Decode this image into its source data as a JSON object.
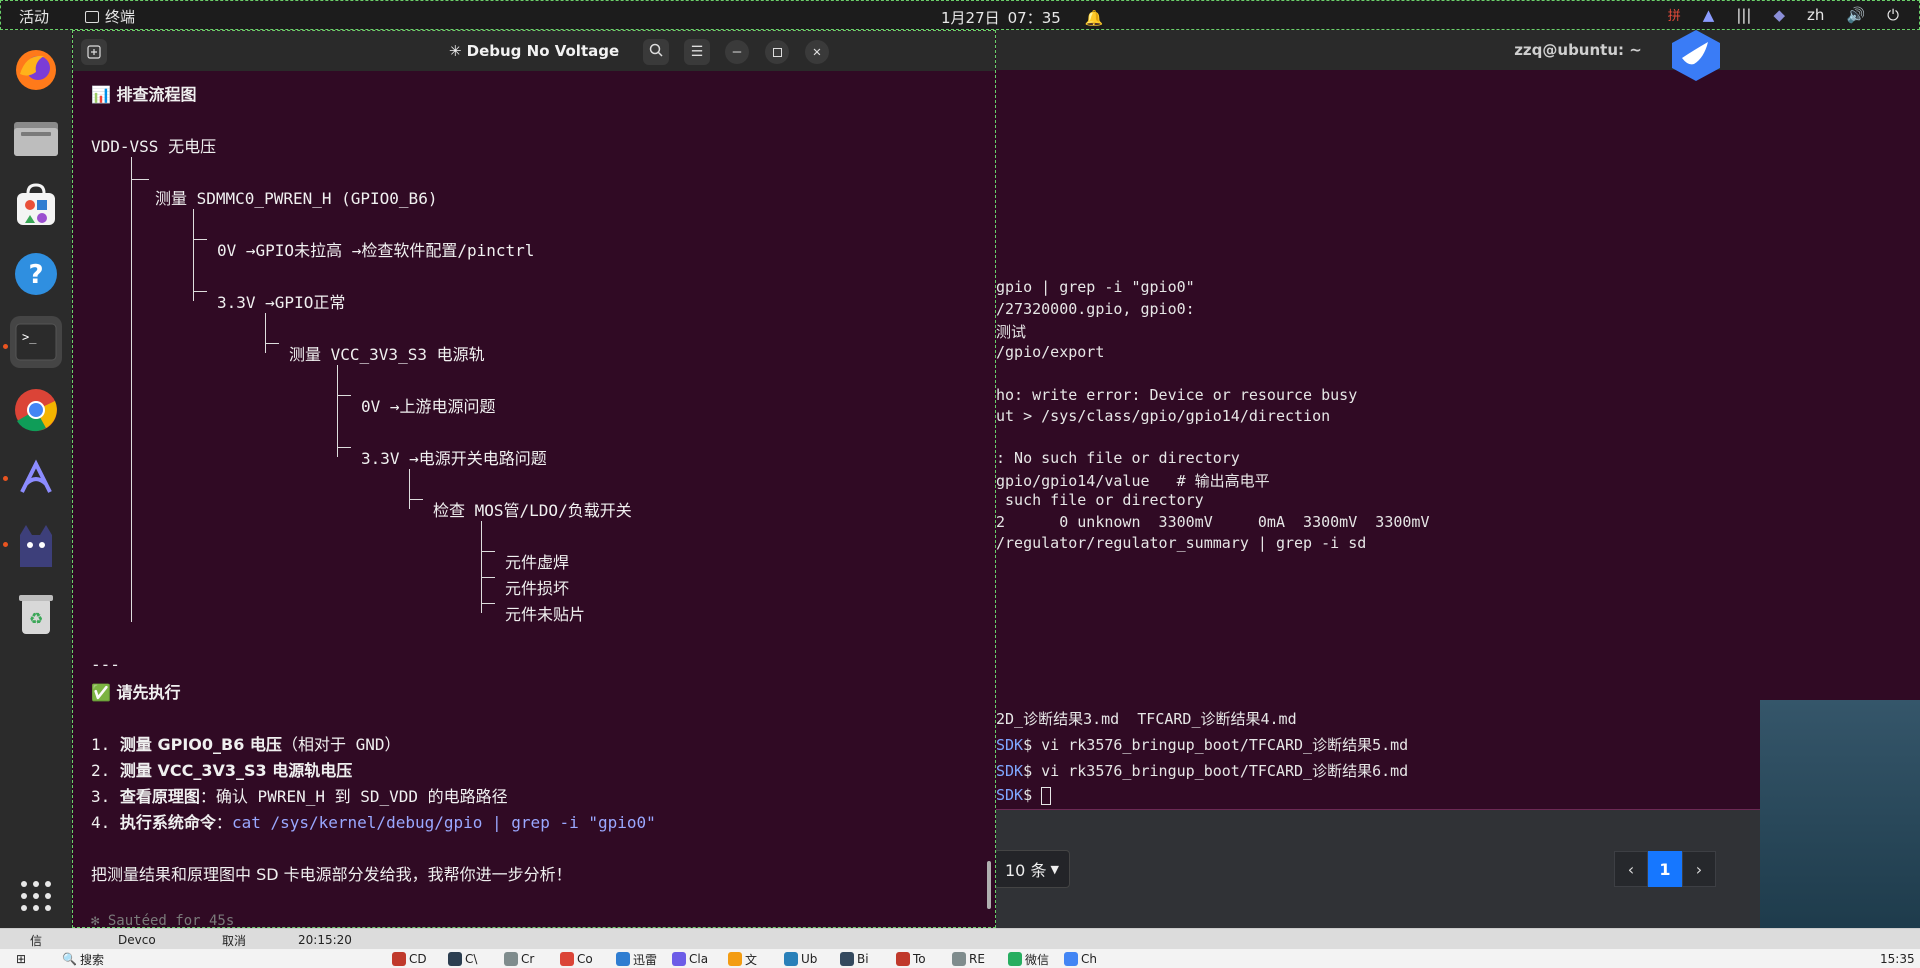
{
  "topbar": {
    "activities": "活动",
    "app_name": "终端",
    "date": "1月27日",
    "time": "07：35",
    "lang": "zh"
  },
  "claude_window": {
    "title": "✳ Debug No Voltage",
    "heading_flow": "📊 排查流程图",
    "root": "VDD-VSS 无电压",
    "n1": "测量 SDMMC0_PWREN_H (GPIO0_B6)",
    "n1a": "0V →GPIO未拉高 →检查软件配置/pinctrl",
    "n1b": "3.3V →GPIO正常",
    "n2": "测量 VCC_3V3_S3 电源轨",
    "n2a": "0V →上游电源问题",
    "n2b": "3.3V →电源开关电路问题",
    "n3": "检查 MOS管/LDO/负载开关",
    "leaf1": "元件虚焊",
    "leaf2": "元件损坏",
    "leaf3": "元件未贴片",
    "separator": "---",
    "heading_exec": "✅ 请先执行",
    "step1_num": "1.",
    "step1_bold": "测量 GPIO0_B6 电压",
    "step1_rest": "（相对于 GND）",
    "step2_num": "2.",
    "step2_bold": "测量 VCC_3V3_S3 电源轨电压",
    "step3_num": "3.",
    "step3_bold": "查看原理图",
    "step3_rest": "：确认 PWREN_H 到 SD_VDD 的电路路径",
    "step4_num": "4.",
    "step4_bold": "执行系统命令",
    "step4_sep": "：",
    "step4_cmd": "cat /sys/kernel/debug/gpio | grep -i \"gpio0\"",
    "closing": "把测量结果和原理图中 SD 卡电源部分发给我，我帮你进一步分析！",
    "status": "✻ Sautéed for 45s"
  },
  "right_terminal": {
    "title": "zzq@ubuntu: ~",
    "lines": [
      "gpio | grep -i \"gpio0\"",
      "/27320000.gpio, gpio0:",
      "测试",
      "/gpio/export",
      "",
      "ho: write error: Device or resource busy",
      "ut > /sys/class/gpio/gpio14/direction",
      "",
      ": No such file or directory",
      "gpio/gpio14/value   # 输出高电平",
      " such file or directory",
      "2      0 unknown  3300mV     0mA  3300mV  3300mV",
      "/regulator/regulator_summary | grep -i sd"
    ]
  },
  "lower_terminal": {
    "line1": "2D_诊断结果3.md  TFCARD_诊断结果4.md",
    "line2_prompt": "SDK",
    "line2_cmd": "$ vi rk3576_bringup_boot/TFCARD_诊断结果5.md",
    "line3_prompt": "SDK",
    "line3_cmd": "$ vi rk3576_bringup_boot/TFCARD_诊断结果6.md",
    "line4_prompt": "SDK",
    "line4_cmd": "$ "
  },
  "web": {
    "page_size": "10 条",
    "page_current": "1"
  },
  "taskbar": {
    "clock": "15:35",
    "top_items": [
      "信",
      "Devco",
      "取消",
      "20:15:20"
    ],
    "apps": [
      "CD",
      "C\\",
      "Cr",
      "Co",
      "迅雷",
      "Cla",
      "文",
      "Ub",
      "Bi",
      "To",
      "RE",
      "微信",
      "Ch"
    ],
    "search": "搜索"
  }
}
